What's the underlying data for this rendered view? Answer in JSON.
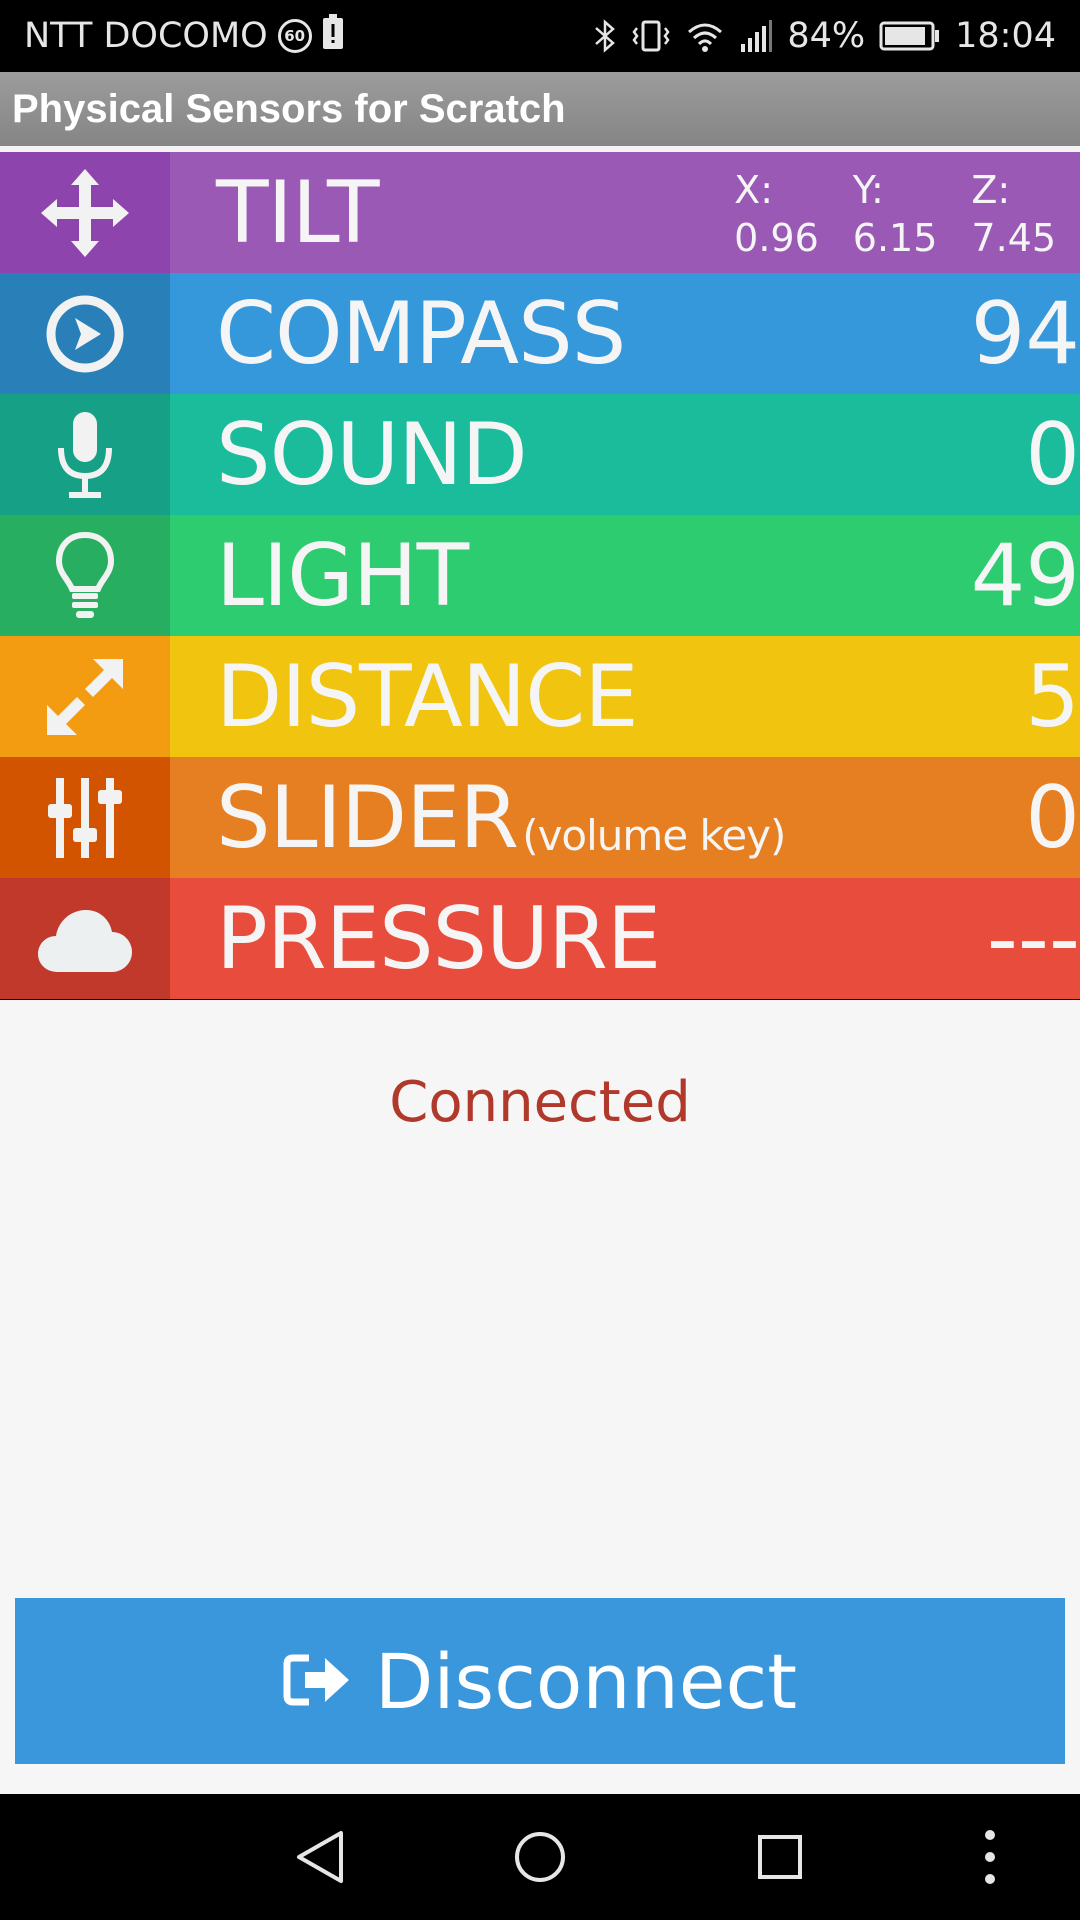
{
  "status_bar": {
    "carrier": "NTT DOCOMO",
    "badge": "60",
    "battery_percent": "84%",
    "time": "18:04"
  },
  "app": {
    "title": "Physical Sensors for Scratch"
  },
  "sensors": {
    "tilt": {
      "label": "TILT",
      "x_label": "X:",
      "x": "0.96",
      "y_label": "Y:",
      "y": "6.15",
      "z_label": "Z:",
      "z": "7.45",
      "icon_color": "#8e44ad",
      "color": "#9b59b6"
    },
    "compass": {
      "label": "COMPASS",
      "value": "94",
      "icon_color": "#2980b9",
      "color": "#3498db"
    },
    "sound": {
      "label": "SOUND",
      "value": "0",
      "icon_color": "#16a085",
      "color": "#1abc9c"
    },
    "light": {
      "label": "LIGHT",
      "value": "49",
      "icon_color": "#27ae60",
      "color": "#2ecc71"
    },
    "distance": {
      "label": "DISTANCE",
      "value": "5",
      "icon_color": "#f39c12",
      "color": "#f1c40f"
    },
    "slider": {
      "label": "SLIDER",
      "sublabel": "(volume key)",
      "value": "0",
      "icon_color": "#d35400",
      "color": "#e67e22"
    },
    "pressure": {
      "label": "PRESSURE",
      "value": "---",
      "icon_color": "#c0392b",
      "color": "#e74c3c"
    }
  },
  "connection": {
    "status": "Connected",
    "button_label": "Disconnect"
  },
  "nav": {
    "back": "back-icon",
    "home": "home-icon",
    "recents": "recents-icon",
    "menu": "menu-icon"
  }
}
